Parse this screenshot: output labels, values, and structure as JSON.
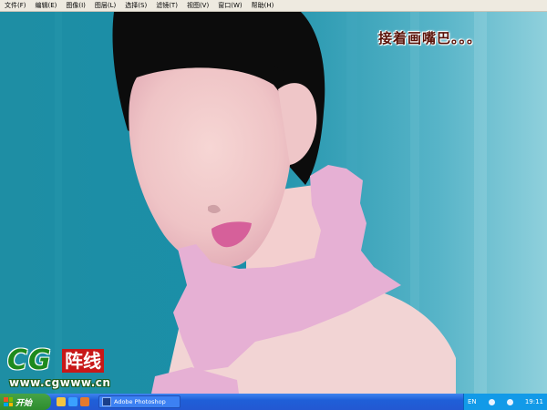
{
  "menu": {
    "items": [
      {
        "label": "文件(F)"
      },
      {
        "label": "编辑(E)"
      },
      {
        "label": "图像(I)"
      },
      {
        "label": "图层(L)"
      },
      {
        "label": "选择(S)"
      },
      {
        "label": "滤镜(T)"
      },
      {
        "label": "视图(V)"
      },
      {
        "label": "窗口(W)"
      },
      {
        "label": "帮助(H)"
      }
    ]
  },
  "canvas": {
    "caption": "接着画嘴巴。。。"
  },
  "watermark": {
    "logo_text": "CG",
    "logo_tag": "阵线",
    "url": "www.cgwww.cn"
  },
  "taskbar": {
    "start_label": "开始",
    "task_label": "Adobe Photoshop",
    "lang": "EN",
    "clock": "19:11"
  },
  "colors": {
    "background": "#1a8aa0",
    "skin": "#f1c9c9",
    "scarf": "#e6b0d4",
    "hair": "#0c0c0c",
    "lips": "#d6609a"
  }
}
